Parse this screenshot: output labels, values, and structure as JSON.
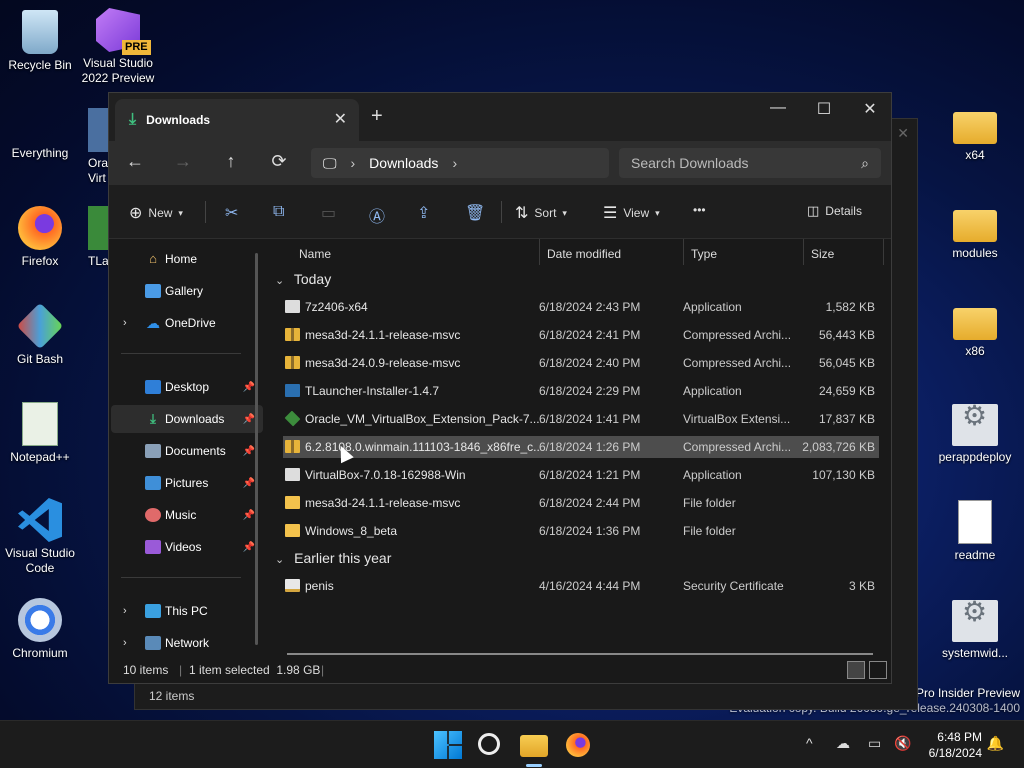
{
  "desktop": {
    "left_icons": [
      {
        "label": "Recycle Bin"
      },
      {
        "label": "Visual Studio\n2022 Preview",
        "badge": "PRE"
      },
      {
        "label": "Everything"
      },
      {
        "label": "Firefox"
      },
      {
        "label": "Git Bash"
      },
      {
        "label": "Notepad++"
      },
      {
        "label": "Visual Studio\nCode"
      },
      {
        "label": "Chromium"
      }
    ],
    "partial_icons": [
      {
        "label": "Ora\nVirt"
      },
      {
        "label": "TLa"
      }
    ],
    "right_icons": [
      {
        "label": "x64"
      },
      {
        "label": "modules"
      },
      {
        "label": "x86"
      },
      {
        "label": "perappdeploy"
      },
      {
        "label": "readme"
      },
      {
        "label": "systemwid..."
      }
    ],
    "watermark": {
      "line1": "Pro Insider Preview",
      "line2": "Evaluation copy. Build 26080.ge_release.240308-1400"
    }
  },
  "back_window": {
    "status": "12 items"
  },
  "window": {
    "tab_title": "Downloads",
    "tab_close": "✕",
    "new_tab": "+",
    "controls": {
      "minimize": "—",
      "maximize": "☐",
      "close": "✕"
    },
    "nav": {
      "back": "←",
      "forward": "→",
      "up": "↑",
      "refresh": "⟳",
      "path_sep": "›"
    },
    "address": {
      "location": "Downloads"
    },
    "search": {
      "placeholder": "Search Downloads",
      "icon": "⌕"
    },
    "toolbar": {
      "new_label": "New",
      "sort_label": "Sort",
      "view_label": "View",
      "more": "•••",
      "details_label": "Details"
    },
    "sidebar": {
      "home": "Home",
      "gallery": "Gallery",
      "onedrive": "OneDrive",
      "pinned": [
        "Desktop",
        "Downloads",
        "Documents",
        "Pictures",
        "Music",
        "Videos"
      ],
      "this_pc": "This PC",
      "network": "Network"
    },
    "columns": {
      "name": "Name",
      "date": "Date modified",
      "type": "Type",
      "size": "Size"
    },
    "groups": {
      "today": "Today",
      "earlier": "Earlier this year"
    },
    "files_today": [
      {
        "name": "7z2406-x64",
        "date": "6/18/2024 2:43 PM",
        "type": "Application",
        "size": "1,582 KB",
        "icon": "app"
      },
      {
        "name": "mesa3d-24.1.1-release-msvc",
        "date": "6/18/2024 2:41 PM",
        "type": "Compressed Archi...",
        "size": "56,443 KB",
        "icon": "zip"
      },
      {
        "name": "mesa3d-24.0.9-release-msvc",
        "date": "6/18/2024 2:40 PM",
        "type": "Compressed Archi...",
        "size": "56,045 KB",
        "icon": "zip"
      },
      {
        "name": "TLauncher-Installer-1.4.7",
        "date": "6/18/2024 2:29 PM",
        "type": "Application",
        "size": "24,659 KB",
        "icon": "tl"
      },
      {
        "name": "Oracle_VM_VirtualBox_Extension_Pack-7....",
        "date": "6/18/2024 1:41 PM",
        "type": "VirtualBox Extensi...",
        "size": "17,837 KB",
        "icon": "vbox"
      },
      {
        "name": "6.2.8108.0.winmain.111103-1846_x86fre_c...",
        "date": "6/18/2024 1:26 PM",
        "type": "Compressed Archi...",
        "size": "2,083,726 KB",
        "icon": "zip",
        "selected": true
      },
      {
        "name": "VirtualBox-7.0.18-162988-Win",
        "date": "6/18/2024 1:21 PM",
        "type": "Application",
        "size": "107,130 KB",
        "icon": "app"
      },
      {
        "name": "mesa3d-24.1.1-release-msvc",
        "date": "6/18/2024 2:44 PM",
        "type": "File folder",
        "size": "",
        "icon": "folder"
      },
      {
        "name": "Windows_8_beta",
        "date": "6/18/2024 1:36 PM",
        "type": "File folder",
        "size": "",
        "icon": "folder"
      }
    ],
    "files_earlier": [
      {
        "name": "penis",
        "date": "4/16/2024 4:44 PM",
        "type": "Security Certificate",
        "size": "3 KB",
        "icon": "cert"
      }
    ],
    "status": {
      "count": "10 items",
      "selected": "1 item selected  1.98 GB"
    }
  },
  "taskbar": {
    "clock_time": "6:48 PM",
    "clock_date": "6/18/2024",
    "tray_chevron": "^"
  }
}
